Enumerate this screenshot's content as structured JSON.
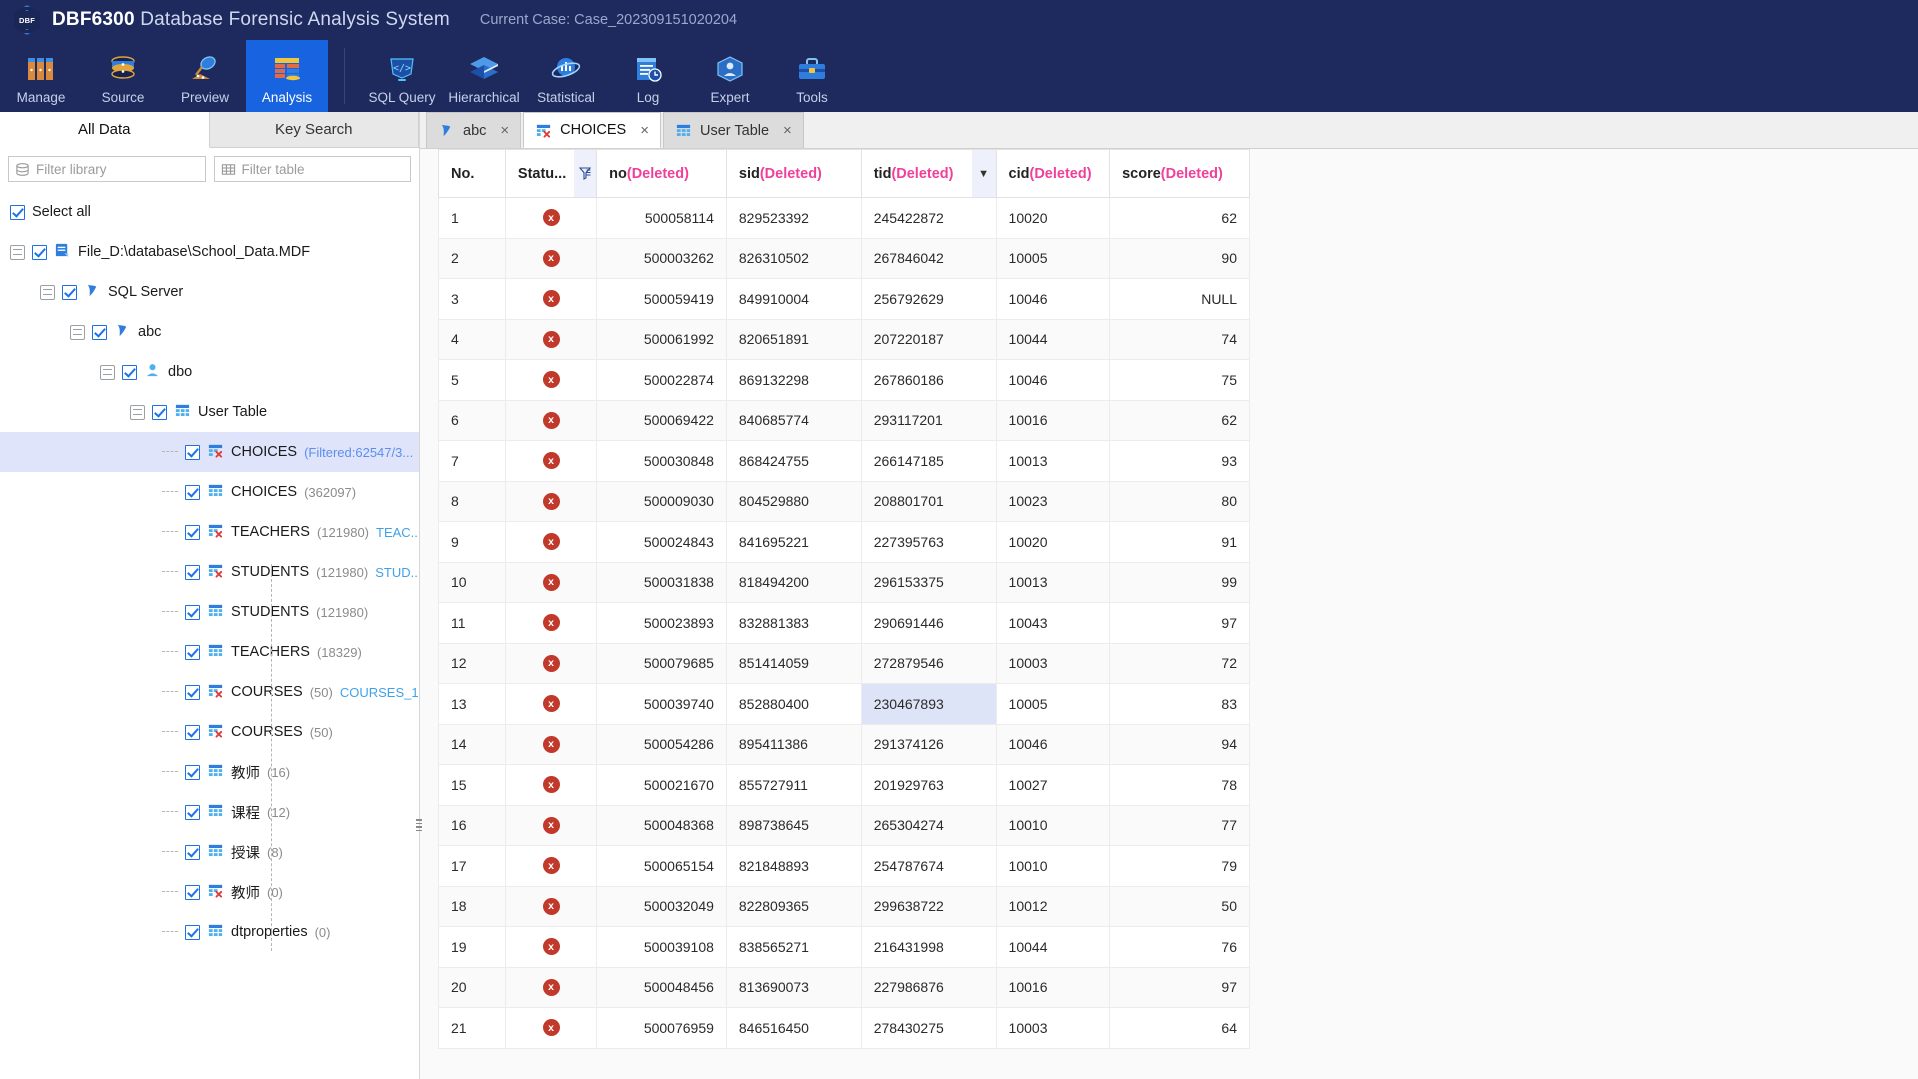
{
  "titlebar": {
    "logo_text": "DBF",
    "app_name_bold": "DBF6300",
    "app_name_rest": "Database Forensic Analysis System",
    "case_label": "Current Case: Case_202309151020204"
  },
  "ribbon": {
    "items": [
      {
        "label": "Manage",
        "icon": "database-stack-icon",
        "active": false
      },
      {
        "label": "Source",
        "icon": "database-cylinder-icon",
        "active": false
      },
      {
        "label": "Preview",
        "icon": "magnifier-icon",
        "active": false
      },
      {
        "label": "Analysis",
        "icon": "table-analysis-icon",
        "active": true
      },
      {
        "label": "SQL Query",
        "icon": "code-brackets-icon",
        "active": false
      },
      {
        "label": "Hierarchical",
        "icon": "layers-icon",
        "active": false
      },
      {
        "label": "Statistical",
        "icon": "chart-orbit-icon",
        "active": false
      },
      {
        "label": "Log",
        "icon": "log-clock-icon",
        "active": false
      },
      {
        "label": "Expert",
        "icon": "expert-box-icon",
        "active": false
      },
      {
        "label": "Tools",
        "icon": "toolbox-icon",
        "active": false
      }
    ]
  },
  "left_panel": {
    "tabs": [
      {
        "label": "All Data",
        "active": true
      },
      {
        "label": "Key Search",
        "active": false
      }
    ],
    "filter_library_placeholder": "Filter library",
    "filter_table_placeholder": "Filter table",
    "select_all_label": "Select all",
    "tree": [
      {
        "label": "File_D:\\database\\School_Data.MDF",
        "count": "",
        "alias": "",
        "indent": 0,
        "icon": "file-mdf-icon",
        "expander": true,
        "selected": false,
        "tick": false
      },
      {
        "label": "SQL Server",
        "count": "",
        "alias": "",
        "indent": 1,
        "icon": "server-icon",
        "expander": true,
        "selected": false,
        "tick": false
      },
      {
        "label": "abc",
        "count": "",
        "alias": "",
        "indent": 2,
        "icon": "server-icon",
        "expander": true,
        "selected": false,
        "tick": false
      },
      {
        "label": "dbo",
        "count": "",
        "alias": "",
        "indent": 3,
        "icon": "user-icon",
        "expander": true,
        "selected": false,
        "tick": false
      },
      {
        "label": "User Table",
        "count": "",
        "alias": "",
        "indent": 4,
        "icon": "table-icon",
        "expander": true,
        "selected": false,
        "tick": false
      },
      {
        "label": "CHOICES",
        "count": "(Filtered:62547/3...",
        "alias": "",
        "indent": 5,
        "icon": "table-deleted-icon",
        "expander": false,
        "selected": true,
        "tick": true,
        "count_style": "filtered"
      },
      {
        "label": "CHOICES",
        "count": "(362097)",
        "alias": "",
        "indent": 5,
        "icon": "table-icon",
        "expander": false,
        "selected": false,
        "tick": true
      },
      {
        "label": "TEACHERS",
        "count": "(121980)",
        "alias": "TEAC...",
        "indent": 5,
        "icon": "table-deleted-icon",
        "expander": false,
        "selected": false,
        "tick": true
      },
      {
        "label": "STUDENTS",
        "count": "(121980)",
        "alias": "STUD...",
        "indent": 5,
        "icon": "table-deleted-icon",
        "expander": false,
        "selected": false,
        "tick": true
      },
      {
        "label": "STUDENTS",
        "count": "(121980)",
        "alias": "",
        "indent": 5,
        "icon": "table-icon",
        "expander": false,
        "selected": false,
        "tick": true
      },
      {
        "label": "TEACHERS",
        "count": "(18329)",
        "alias": "",
        "indent": 5,
        "icon": "table-icon",
        "expander": false,
        "selected": false,
        "tick": true
      },
      {
        "label": "COURSES",
        "count": "(50)",
        "alias": "COURSES_1",
        "indent": 5,
        "icon": "table-deleted-icon",
        "expander": false,
        "selected": false,
        "tick": true
      },
      {
        "label": "COURSES",
        "count": "(50)",
        "alias": "",
        "indent": 5,
        "icon": "table-deleted-icon",
        "expander": false,
        "selected": false,
        "tick": true
      },
      {
        "label": "教师",
        "count": "(16)",
        "alias": "",
        "indent": 5,
        "icon": "table-icon",
        "expander": false,
        "selected": false,
        "tick": true
      },
      {
        "label": "课程",
        "count": "(12)",
        "alias": "",
        "indent": 5,
        "icon": "table-icon",
        "expander": false,
        "selected": false,
        "tick": true
      },
      {
        "label": "授课",
        "count": "(8)",
        "alias": "",
        "indent": 5,
        "icon": "table-icon",
        "expander": false,
        "selected": false,
        "tick": true
      },
      {
        "label": "教师",
        "count": "(0)",
        "alias": "",
        "indent": 5,
        "icon": "table-deleted-icon",
        "expander": false,
        "selected": false,
        "tick": true
      },
      {
        "label": "dtproperties",
        "count": "(0)",
        "alias": "",
        "indent": 5,
        "icon": "table-icon",
        "expander": false,
        "selected": false,
        "tick": true
      }
    ]
  },
  "data_tabs": [
    {
      "label": "abc",
      "icon": "server-icon",
      "active": false,
      "close": "×"
    },
    {
      "label": "CHOICES",
      "icon": "table-deleted-icon",
      "active": true,
      "close": "×"
    },
    {
      "label": "User Table",
      "icon": "table-icon",
      "active": false,
      "close": "×"
    }
  ],
  "grid": {
    "columns": [
      {
        "key": "no",
        "label": "No.",
        "deleted": "",
        "badge": "none"
      },
      {
        "key": "status",
        "label": "Statu...",
        "deleted": "",
        "badge": "filter"
      },
      {
        "key": "c_no",
        "label": "no",
        "deleted": "(Deleted)",
        "badge": "none"
      },
      {
        "key": "c_sid",
        "label": "sid",
        "deleted": "(Deleted)",
        "badge": "none"
      },
      {
        "key": "c_tid",
        "label": "tid",
        "deleted": "(Deleted)",
        "badge": "sort-desc"
      },
      {
        "key": "c_cid",
        "label": "cid",
        "deleted": "(Deleted)",
        "badge": "none"
      },
      {
        "key": "c_score",
        "label": "score",
        "deleted": "(Deleted)",
        "badge": "none"
      }
    ],
    "status_glyph": "x",
    "selected_cell": {
      "row": 13,
      "column": "c_tid"
    },
    "rows": [
      {
        "no": "1",
        "c_no": "500058114",
        "c_sid": "829523392",
        "c_tid": "245422872",
        "c_cid": "10020",
        "c_score": "62"
      },
      {
        "no": "2",
        "c_no": "500003262",
        "c_sid": "826310502",
        "c_tid": "267846042",
        "c_cid": "10005",
        "c_score": "90"
      },
      {
        "no": "3",
        "c_no": "500059419",
        "c_sid": "849910004",
        "c_tid": "256792629",
        "c_cid": "10046",
        "c_score": "NULL"
      },
      {
        "no": "4",
        "c_no": "500061992",
        "c_sid": "820651891",
        "c_tid": "207220187",
        "c_cid": "10044",
        "c_score": "74"
      },
      {
        "no": "5",
        "c_no": "500022874",
        "c_sid": "869132298",
        "c_tid": "267860186",
        "c_cid": "10046",
        "c_score": "75"
      },
      {
        "no": "6",
        "c_no": "500069422",
        "c_sid": "840685774",
        "c_tid": "293117201",
        "c_cid": "10016",
        "c_score": "62"
      },
      {
        "no": "7",
        "c_no": "500030848",
        "c_sid": "868424755",
        "c_tid": "266147185",
        "c_cid": "10013",
        "c_score": "93"
      },
      {
        "no": "8",
        "c_no": "500009030",
        "c_sid": "804529880",
        "c_tid": "208801701",
        "c_cid": "10023",
        "c_score": "80"
      },
      {
        "no": "9",
        "c_no": "500024843",
        "c_sid": "841695221",
        "c_tid": "227395763",
        "c_cid": "10020",
        "c_score": "91"
      },
      {
        "no": "10",
        "c_no": "500031838",
        "c_sid": "818494200",
        "c_tid": "296153375",
        "c_cid": "10013",
        "c_score": "99"
      },
      {
        "no": "11",
        "c_no": "500023893",
        "c_sid": "832881383",
        "c_tid": "290691446",
        "c_cid": "10043",
        "c_score": "97"
      },
      {
        "no": "12",
        "c_no": "500079685",
        "c_sid": "851414059",
        "c_tid": "272879546",
        "c_cid": "10003",
        "c_score": "72"
      },
      {
        "no": "13",
        "c_no": "500039740",
        "c_sid": "852880400",
        "c_tid": "230467893",
        "c_cid": "10005",
        "c_score": "83"
      },
      {
        "no": "14",
        "c_no": "500054286",
        "c_sid": "895411386",
        "c_tid": "291374126",
        "c_cid": "10046",
        "c_score": "94"
      },
      {
        "no": "15",
        "c_no": "500021670",
        "c_sid": "855727911",
        "c_tid": "201929763",
        "c_cid": "10027",
        "c_score": "78"
      },
      {
        "no": "16",
        "c_no": "500048368",
        "c_sid": "898738645",
        "c_tid": "265304274",
        "c_cid": "10010",
        "c_score": "77"
      },
      {
        "no": "17",
        "c_no": "500065154",
        "c_sid": "821848893",
        "c_tid": "254787674",
        "c_cid": "10010",
        "c_score": "79"
      },
      {
        "no": "18",
        "c_no": "500032049",
        "c_sid": "822809365",
        "c_tid": "299638722",
        "c_cid": "10012",
        "c_score": "50"
      },
      {
        "no": "19",
        "c_no": "500039108",
        "c_sid": "838565271",
        "c_tid": "216431998",
        "c_cid": "10044",
        "c_score": "76"
      },
      {
        "no": "20",
        "c_no": "500048456",
        "c_sid": "813690073",
        "c_tid": "227986876",
        "c_cid": "10016",
        "c_score": "97"
      },
      {
        "no": "21",
        "c_no": "500076959",
        "c_sid": "846516450",
        "c_tid": "278430275",
        "c_cid": "10003",
        "c_score": "64"
      }
    ]
  },
  "colors": {
    "header_bg": "#1e2a5e",
    "accent_active": "#1763e0",
    "deleted_pink": "#f0409b",
    "amber_value": "#b5803a",
    "selection_blue": "#dde4f7",
    "tree_selection": "#dfe4fb"
  }
}
